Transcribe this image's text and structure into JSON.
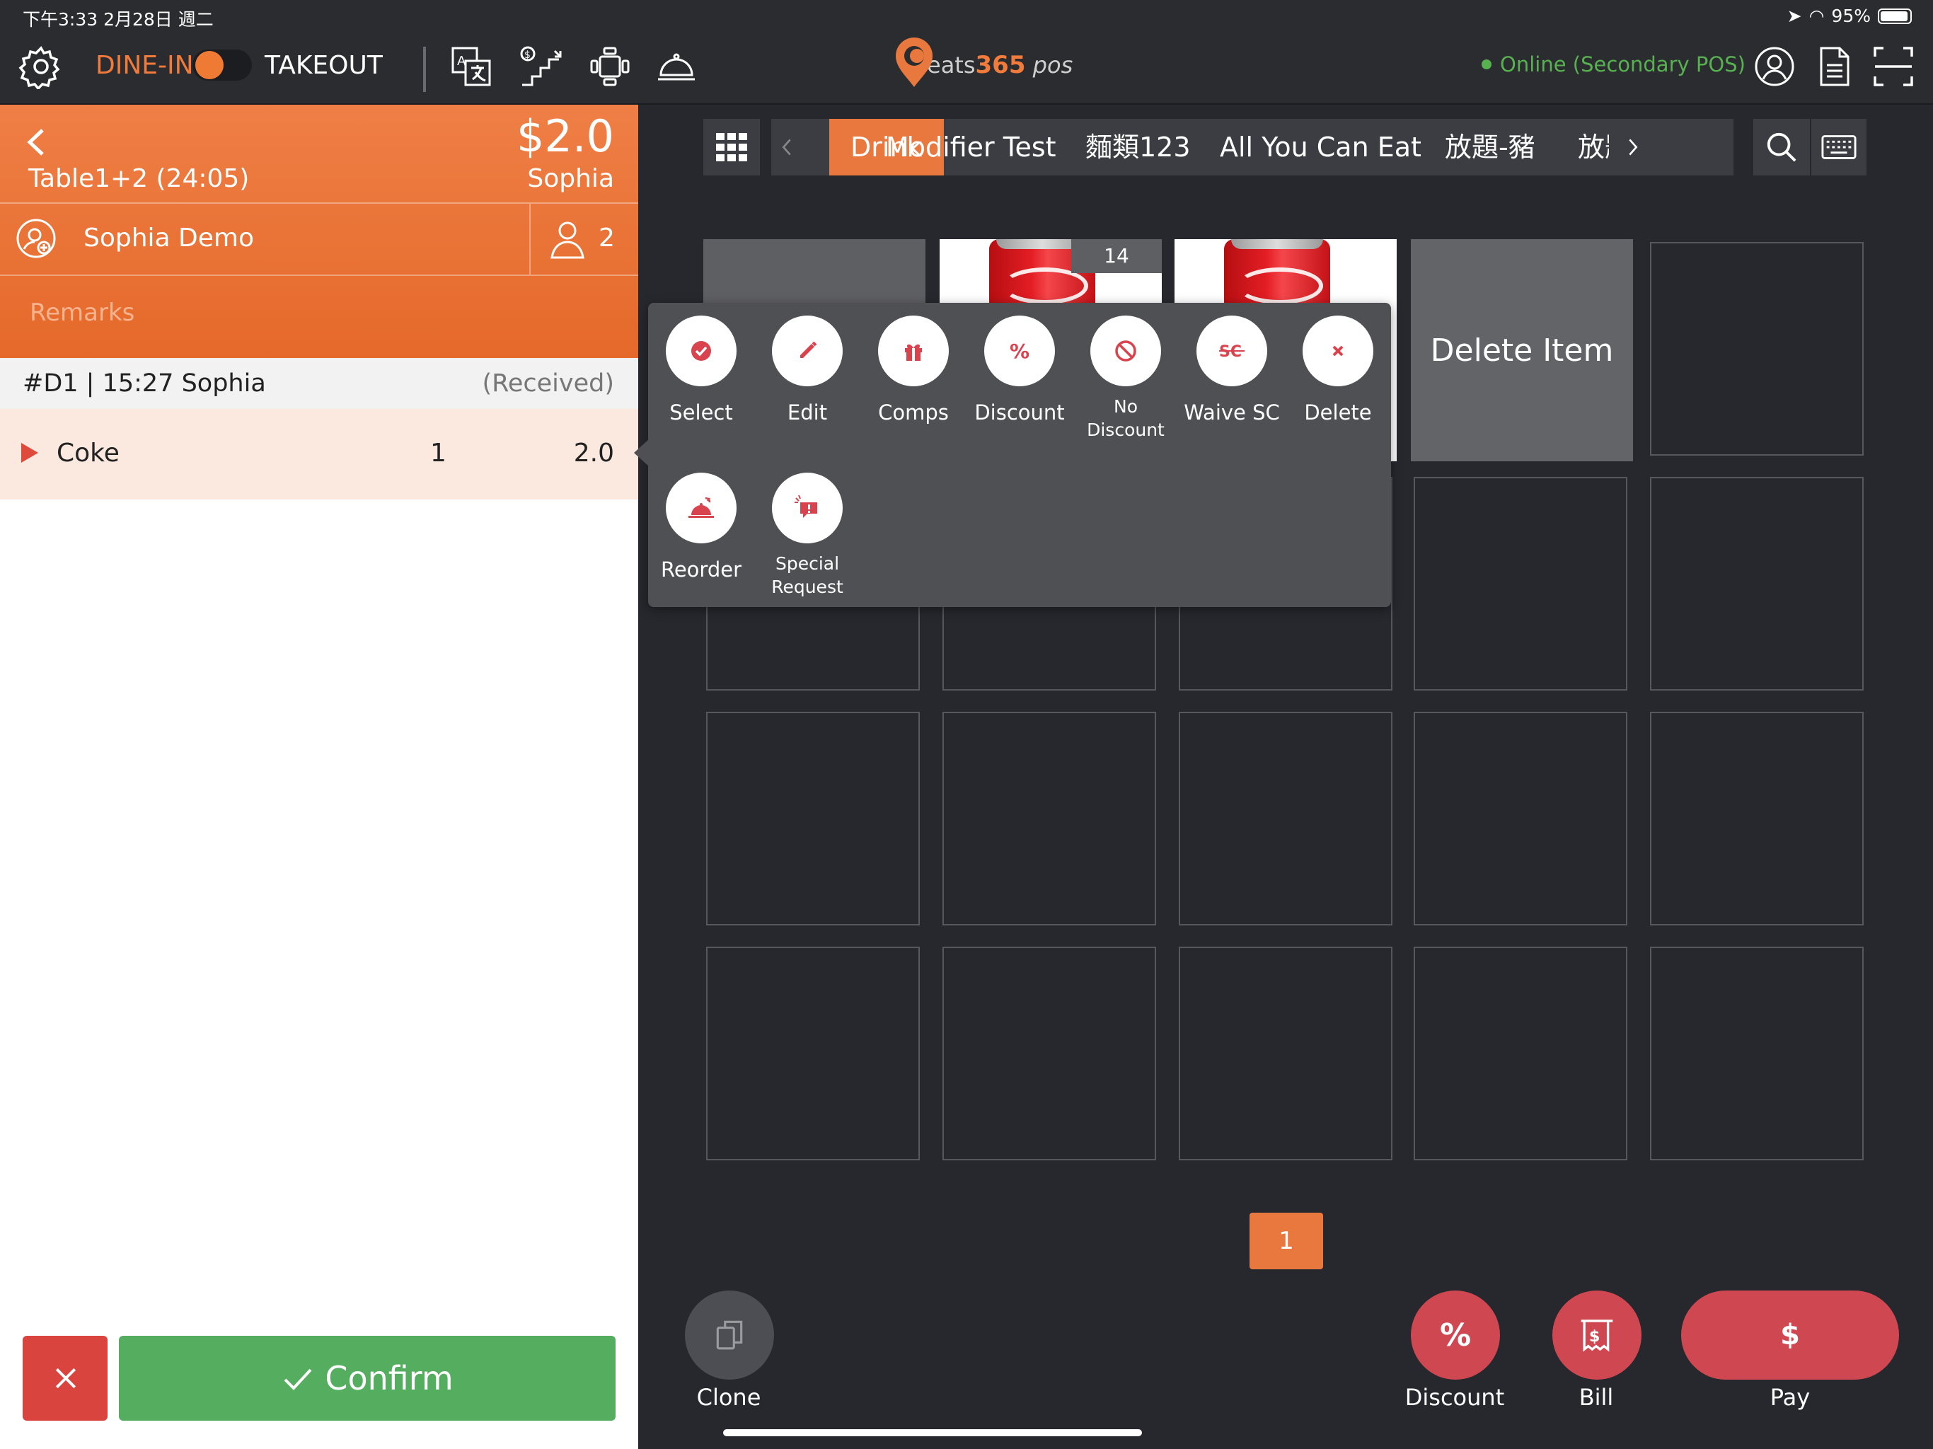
{
  "status_bar": {
    "time_date": "下午3:33   2月28日 週二",
    "battery": "95%"
  },
  "topbar": {
    "dine_in": "DINE-IN",
    "takeout": "TAKEOUT",
    "logo_text": "eats",
    "logo_num": "365",
    "logo_pos": "pos",
    "online_status": "Online (Secondary POS)",
    "icons": [
      "gear-icon",
      "translate-icon",
      "price-step-icon",
      "table-icon",
      "service-bell-icon",
      "user-icon",
      "document-icon",
      "scan-icon"
    ]
  },
  "order": {
    "total": "$2.0",
    "table": "Table1+2 (24:05)",
    "server": "Sophia",
    "customer": "Sophia Demo",
    "guests": "2",
    "remarks_placeholder": "Remarks",
    "order_id": "#D1 | 15:27 Sophia",
    "order_status": "(Received)",
    "items": [
      {
        "name": "Coke",
        "qty": "1",
        "price": "2.0"
      }
    ],
    "confirm_label": "Confirm"
  },
  "categories": {
    "tabs": [
      "Drink",
      "Modifier Test",
      "麵類123",
      "All You Can Eat",
      "放題-豬",
      "放題"
    ],
    "active": "Drink"
  },
  "menu": {
    "stock_badge": "14",
    "delete_item_label": "Delete Item",
    "page": "1"
  },
  "popup": {
    "actions": [
      {
        "label": "Select",
        "icon": "check-circle-icon"
      },
      {
        "label": "Edit",
        "icon": "pencil-icon"
      },
      {
        "label": "Comps",
        "icon": "gift-icon"
      },
      {
        "label": "Discount",
        "icon": "percent-icon"
      },
      {
        "label": "No Discount",
        "icon": "no-symbol-icon"
      },
      {
        "label": "Waive SC",
        "icon": "sc-icon"
      },
      {
        "label": "Delete",
        "icon": "x-icon"
      },
      {
        "label": "Reorder",
        "icon": "cloche-icon"
      },
      {
        "label": "Special Request",
        "icon": "special-request-icon"
      }
    ]
  },
  "bottom_actions": {
    "clone": "Clone",
    "discount": "Discount",
    "bill": "Bill",
    "pay": "Pay",
    "pay_symbol": "$",
    "discount_symbol": "%"
  },
  "colors": {
    "accent": "#E8783D",
    "confirm_green": "#55AD5F",
    "danger_red": "#CF4851",
    "online_green": "#58B150",
    "panel_dark": "#26282D"
  }
}
